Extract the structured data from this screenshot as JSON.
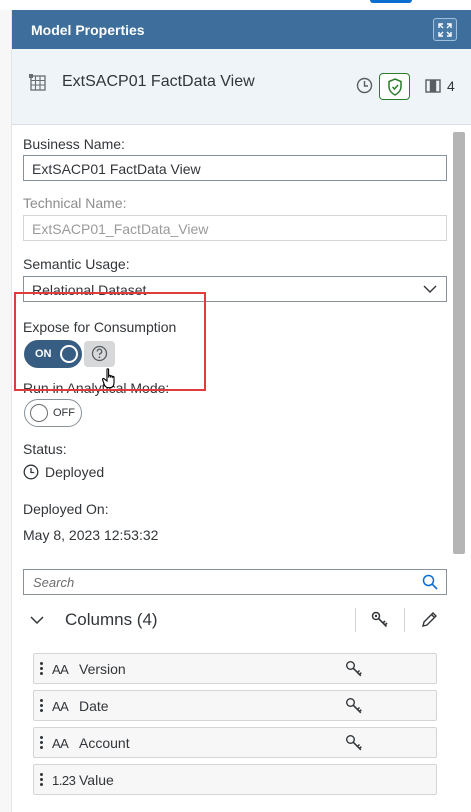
{
  "header": {
    "title": "Model Properties"
  },
  "object": {
    "title": "ExtSACP01 FactData View",
    "columns_count": "4"
  },
  "form": {
    "business_name_label": "Business Name:",
    "business_name_value": "ExtSACP01 FactData View",
    "technical_name_label": "Technical Name:",
    "technical_name_value": "ExtSACP01_FactData_View",
    "semantic_usage_label": "Semantic Usage:",
    "semantic_usage_value": "Relational Dataset",
    "expose_label": "Expose for Consumption",
    "expose_toggle": "ON",
    "analytical_label": "Run in Analytical Mode:",
    "analytical_toggle": "OFF",
    "status_label": "Status:",
    "status_value": "Deployed",
    "deployed_on_label": "Deployed On:",
    "deployed_on_value": "May 8, 2023 12:53:32"
  },
  "search": {
    "placeholder": "Search"
  },
  "columns": {
    "title": "Columns (4)",
    "items": [
      {
        "type": "AA",
        "name": "Version",
        "key": true
      },
      {
        "type": "AA",
        "name": "Date",
        "key": true
      },
      {
        "type": "AA",
        "name": "Account",
        "key": true
      },
      {
        "type": "1.23",
        "name": "Value",
        "key": false
      }
    ]
  },
  "colors": {
    "header_bg": "#3d6e9c",
    "toggle_on": "#385d83",
    "highlight": "#e03c3c",
    "shield": "#2b7d2b"
  },
  "icons": [
    "expand-icon",
    "view-icon",
    "clock-icon",
    "shield-icon",
    "columns-icon",
    "chevron-down-icon",
    "help-icon",
    "search-icon",
    "key-icon",
    "edit-icon"
  ]
}
